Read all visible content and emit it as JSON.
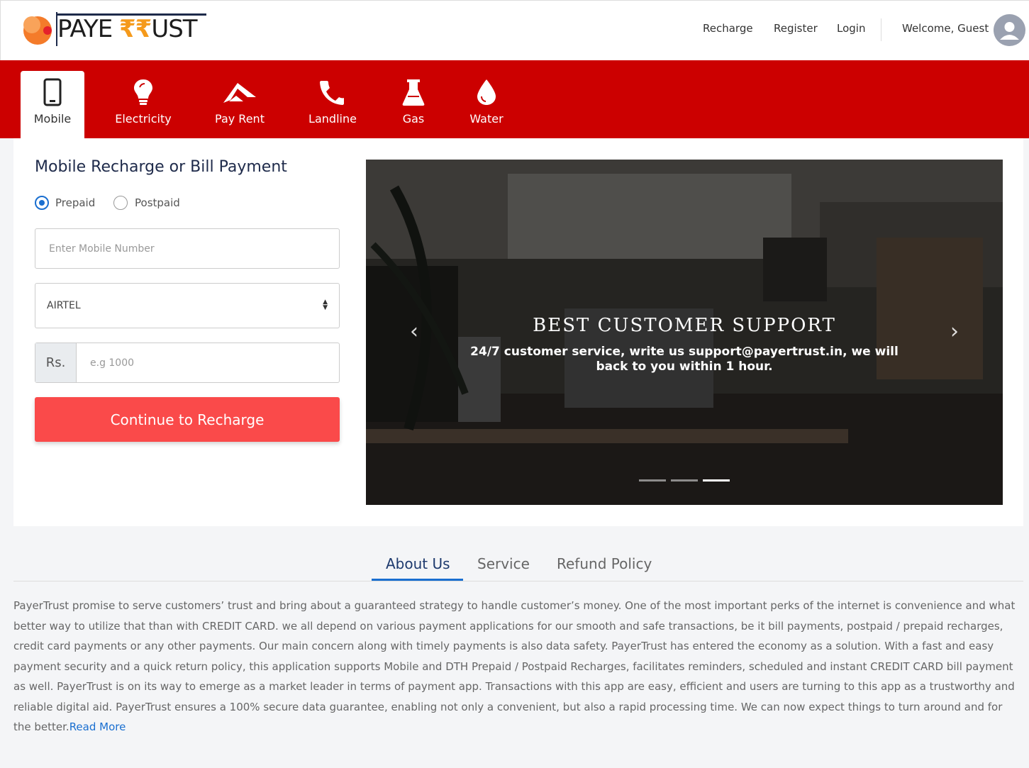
{
  "brand": {
    "logo_text_a": "PAYE ",
    "logo_text_b": "₹₹",
    "logo_text_c": "UST",
    "accent": "#cc0000",
    "cta_color": "#fa4a4a"
  },
  "nav": {
    "recharge": "Recharge",
    "register": "Register",
    "login": "Login",
    "welcome": "Welcome, Guest"
  },
  "categories": [
    {
      "label": "Mobile",
      "icon": "mobile-icon"
    },
    {
      "label": "Electricity",
      "icon": "lightbulb-icon"
    },
    {
      "label": "Pay Rent",
      "icon": "rent-icon"
    },
    {
      "label": "Landline",
      "icon": "phone-icon"
    },
    {
      "label": "Gas",
      "icon": "flask-icon"
    },
    {
      "label": "Water",
      "icon": "drop-icon"
    }
  ],
  "form": {
    "title": "Mobile Recharge or Bill Payment",
    "prepaid": "Prepaid",
    "postpaid": "Postpaid",
    "mobile_placeholder": "Enter Mobile Number",
    "operator": "AIRTEL",
    "currency": "Rs.",
    "amount_placeholder": "e.g 1000",
    "cta": "Continue to Recharge"
  },
  "carousel": {
    "title": "BEST CUSTOMER SUPPORT",
    "text": "24/7 customer service, write us support@payertrust.in, we will back to you within 1 hour.",
    "active_slide": 3,
    "slide_count": 3
  },
  "tabs": {
    "about": "About Us",
    "service": "Service",
    "refund": "Refund Policy"
  },
  "about": {
    "text": "PayerTrust promise to serve customers’ trust and bring about a guaranteed strategy to handle customer’s money. One of the most important perks of the internet is convenience and what better way to utilize that than with CREDIT CARD. we all depend on various payment applications for our smooth and safe transactions, be it bill payments, postpaid / prepaid recharges, credit card payments or any other payments. Our main concern along with timely payments is also data safety. PayerTrust has entered the economy as a solution. With a fast and easy payment security and a quick return policy, this application supports Mobile and DTH Prepaid / Postpaid Recharges, facilitates reminders, scheduled and instant CREDIT CARD bill payment as well. PayerTrust is on its way to emerge as a market leader in terms of payment app. Transactions with this app are easy, efficient and users are turning to this app as a trustworthy and reliable digital aid. PayerTrust ensures a 100% secure data guarantee, enabling not only a convenient, but also a rapid processing time. We can now expect things to turn around and for the better.",
    "read_more": "Read More"
  }
}
